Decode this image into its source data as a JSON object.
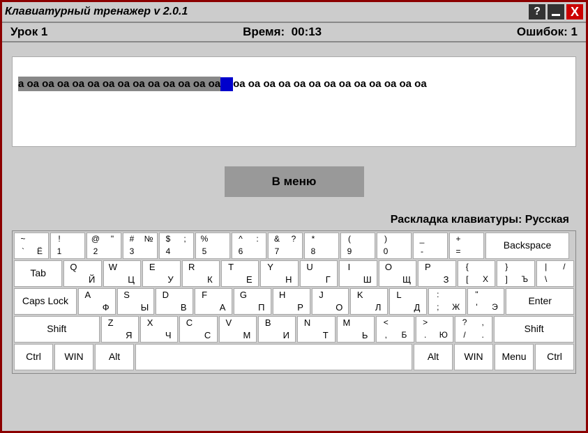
{
  "window": {
    "title": "Клавиатурный тренажер v 2.0.1",
    "help": "?",
    "close": "X"
  },
  "status": {
    "lesson": "Урок 1",
    "time_label": "Время:",
    "time_value": "00:13",
    "errors_label": "Ошибок:",
    "errors_value": "1"
  },
  "typing": {
    "typed": "а оа оа оа оа оа оа оа оа оа оа оа оа оа",
    "remaining": " оа оа оа оа оа оа оа оа оа оа оа оа оа"
  },
  "menu_button": "В меню",
  "layout_label": "Раскладка клавиатуры: Русская",
  "keys": {
    "row1": [
      {
        "tl": "~",
        "tr": "",
        "bl": "`",
        "br": "Ё"
      },
      {
        "tl": "!",
        "tr": "",
        "bl": "1",
        "br": ""
      },
      {
        "tl": "@",
        "tr": "\"",
        "bl": "2",
        "br": ""
      },
      {
        "tl": "#",
        "tr": "№",
        "bl": "3",
        "br": ""
      },
      {
        "tl": "$",
        "tr": ";",
        "bl": "4",
        "br": ""
      },
      {
        "tl": "%",
        "tr": "",
        "bl": "5",
        "br": ""
      },
      {
        "tl": "^",
        "tr": ":",
        "bl": "6",
        "br": ""
      },
      {
        "tl": "&",
        "tr": "?",
        "bl": "7",
        "br": ""
      },
      {
        "tl": "*",
        "tr": "",
        "bl": "8",
        "br": ""
      },
      {
        "tl": "(",
        "tr": "",
        "bl": "9",
        "br": ""
      },
      {
        "tl": ")",
        "tr": "",
        "bl": "0",
        "br": ""
      },
      {
        "tl": "_",
        "tr": "",
        "bl": "-",
        "br": ""
      },
      {
        "tl": "+",
        "tr": "",
        "bl": "=",
        "br": ""
      }
    ],
    "backspace": "Backspace",
    "tab": "Tab",
    "row2": [
      {
        "en": "Q",
        "ru": "Й"
      },
      {
        "en": "W",
        "ru": "Ц"
      },
      {
        "en": "E",
        "ru": "У"
      },
      {
        "en": "R",
        "ru": "К"
      },
      {
        "en": "T",
        "ru": "Е"
      },
      {
        "en": "Y",
        "ru": "Н"
      },
      {
        "en": "U",
        "ru": "Г"
      },
      {
        "en": "I",
        "ru": "Ш"
      },
      {
        "en": "O",
        "ru": "Щ"
      },
      {
        "en": "P",
        "ru": "З"
      },
      {
        "tl": "{",
        "tr": "",
        "bl": "[",
        "br": "Х"
      },
      {
        "tl": "}",
        "tr": "",
        "bl": "]",
        "br": "Ъ"
      },
      {
        "tl": "|",
        "tr": "/",
        "bl": "\\",
        "br": ""
      }
    ],
    "caps": "Caps Lock",
    "row3": [
      {
        "en": "A",
        "ru": "Ф"
      },
      {
        "en": "S",
        "ru": "Ы"
      },
      {
        "en": "D",
        "ru": "В"
      },
      {
        "en": "F",
        "ru": "А"
      },
      {
        "en": "G",
        "ru": "П"
      },
      {
        "en": "H",
        "ru": "Р"
      },
      {
        "en": "J",
        "ru": "О"
      },
      {
        "en": "K",
        "ru": "Л"
      },
      {
        "en": "L",
        "ru": "Д"
      },
      {
        "tl": ":",
        "tr": "",
        "bl": ";",
        "br": "Ж"
      },
      {
        "tl": "\"",
        "tr": "",
        "bl": "'",
        "br": "Э"
      }
    ],
    "enter": "Enter",
    "shift": "Shift",
    "row4": [
      {
        "en": "Z",
        "ru": "Я"
      },
      {
        "en": "X",
        "ru": "Ч"
      },
      {
        "en": "C",
        "ru": "С"
      },
      {
        "en": "V",
        "ru": "М"
      },
      {
        "en": "B",
        "ru": "И"
      },
      {
        "en": "N",
        "ru": "Т"
      },
      {
        "en": "M",
        "ru": "Ь"
      },
      {
        "tl": "<",
        "tr": "",
        "bl": ",",
        "br": "Б"
      },
      {
        "tl": ">",
        "tr": "",
        "bl": ".",
        "br": "Ю"
      },
      {
        "tl": "?",
        "tr": ",",
        "bl": "/",
        "br": "."
      }
    ],
    "ctrl": "Ctrl",
    "win": "WIN",
    "alt": "Alt",
    "menu": "Menu"
  }
}
